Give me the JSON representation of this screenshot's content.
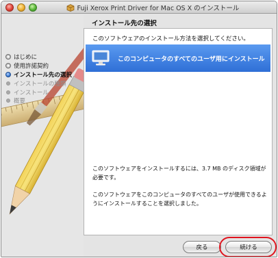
{
  "window": {
    "title": "Fuji Xerox Print Driver for Mac OS X のインストール",
    "title_icon": "installer-box-icon"
  },
  "sidebar": {
    "steps": [
      {
        "label": "はじめに",
        "state": "done"
      },
      {
        "label": "使用許諾契約",
        "state": "done"
      },
      {
        "label": "インストール先の選択",
        "state": "current"
      },
      {
        "label": "インストールの種類",
        "state": "todo"
      },
      {
        "label": "インストール",
        "state": "todo"
      },
      {
        "label": "概要",
        "state": "todo"
      }
    ]
  },
  "main": {
    "section_title": "インストール先の選択",
    "instruction": "このソフトウェアのインストール方法を選択してください。",
    "destination": {
      "label": "このコンピュータのすべてのユーザ用にインストール",
      "icon": "monitor-icon",
      "selected": true
    },
    "info_space": "このソフトウェアをインストールするには、3.7 MB のディスク領域が必要です。",
    "info_choice": "このソフトウェアをこのコンピュータのすべてのユーザが使用できるようにインストールすることを選択しました。"
  },
  "buttons": {
    "back": "戻る",
    "continue": "続ける"
  },
  "colors": {
    "selection": "#3a7bd5",
    "highlight_ring": "#e0141e"
  }
}
